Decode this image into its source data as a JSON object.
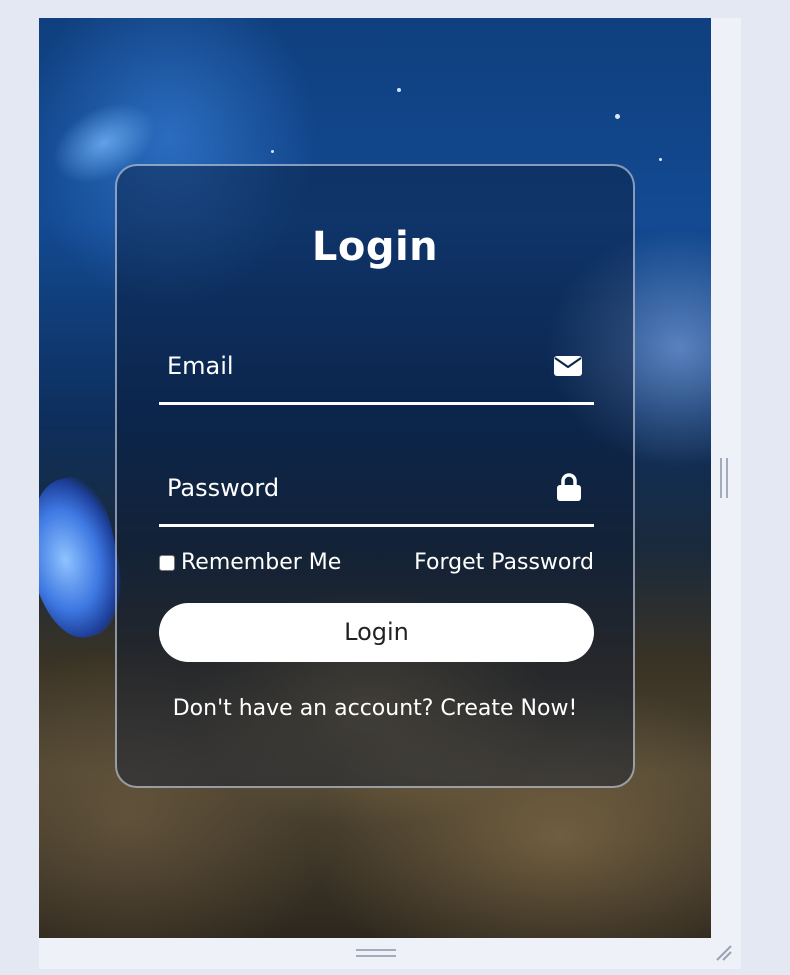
{
  "login": {
    "title": "Login",
    "email_label": "Email",
    "password_label": "Password",
    "remember_label": "Remember Me",
    "remember_checked": false,
    "forgot_label": "Forget Password",
    "login_button": "Login",
    "signup_text": "Don't have an account? Create Now!"
  },
  "icons": {
    "email": "envelope-icon",
    "password": "lock-icon"
  },
  "colors": {
    "text": "#ffffff",
    "button_bg": "#ffffff",
    "button_text": "#222222",
    "card_border": "#e6ecff"
  }
}
